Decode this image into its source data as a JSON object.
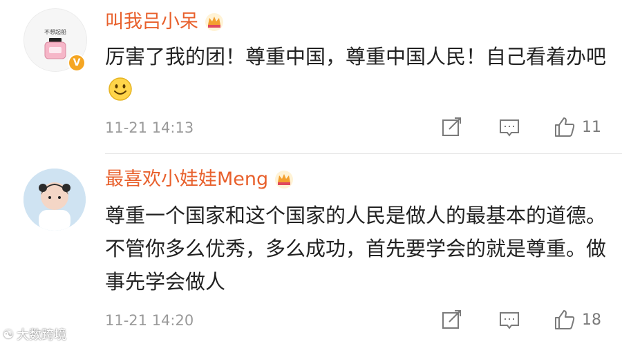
{
  "comments": [
    {
      "username": "叫我吕小呆",
      "avatar_text": "不想起船",
      "verified_badge": "V",
      "text": "厉害了我的团！尊重中国，尊重中国人民！自己看着办吧",
      "emoji": "smiley-face-icon",
      "time": "11-21 14:13",
      "like_count": "11"
    },
    {
      "username": "最喜欢小娃娃Meng",
      "text": "尊重一个国家和这个国家的人民是做人的最基本的道德。不管你多么优秀，多么成功，首先要学会的就是尊重。做事先学会做人",
      "time": "11-21 14:20",
      "like_count": "18"
    }
  ],
  "watermark": {
    "text": "大数跨境"
  },
  "colors": {
    "username": "#e8602c",
    "crown": "#f3a02f",
    "meta": "#9a9a9a",
    "badge": "#f5a623"
  }
}
